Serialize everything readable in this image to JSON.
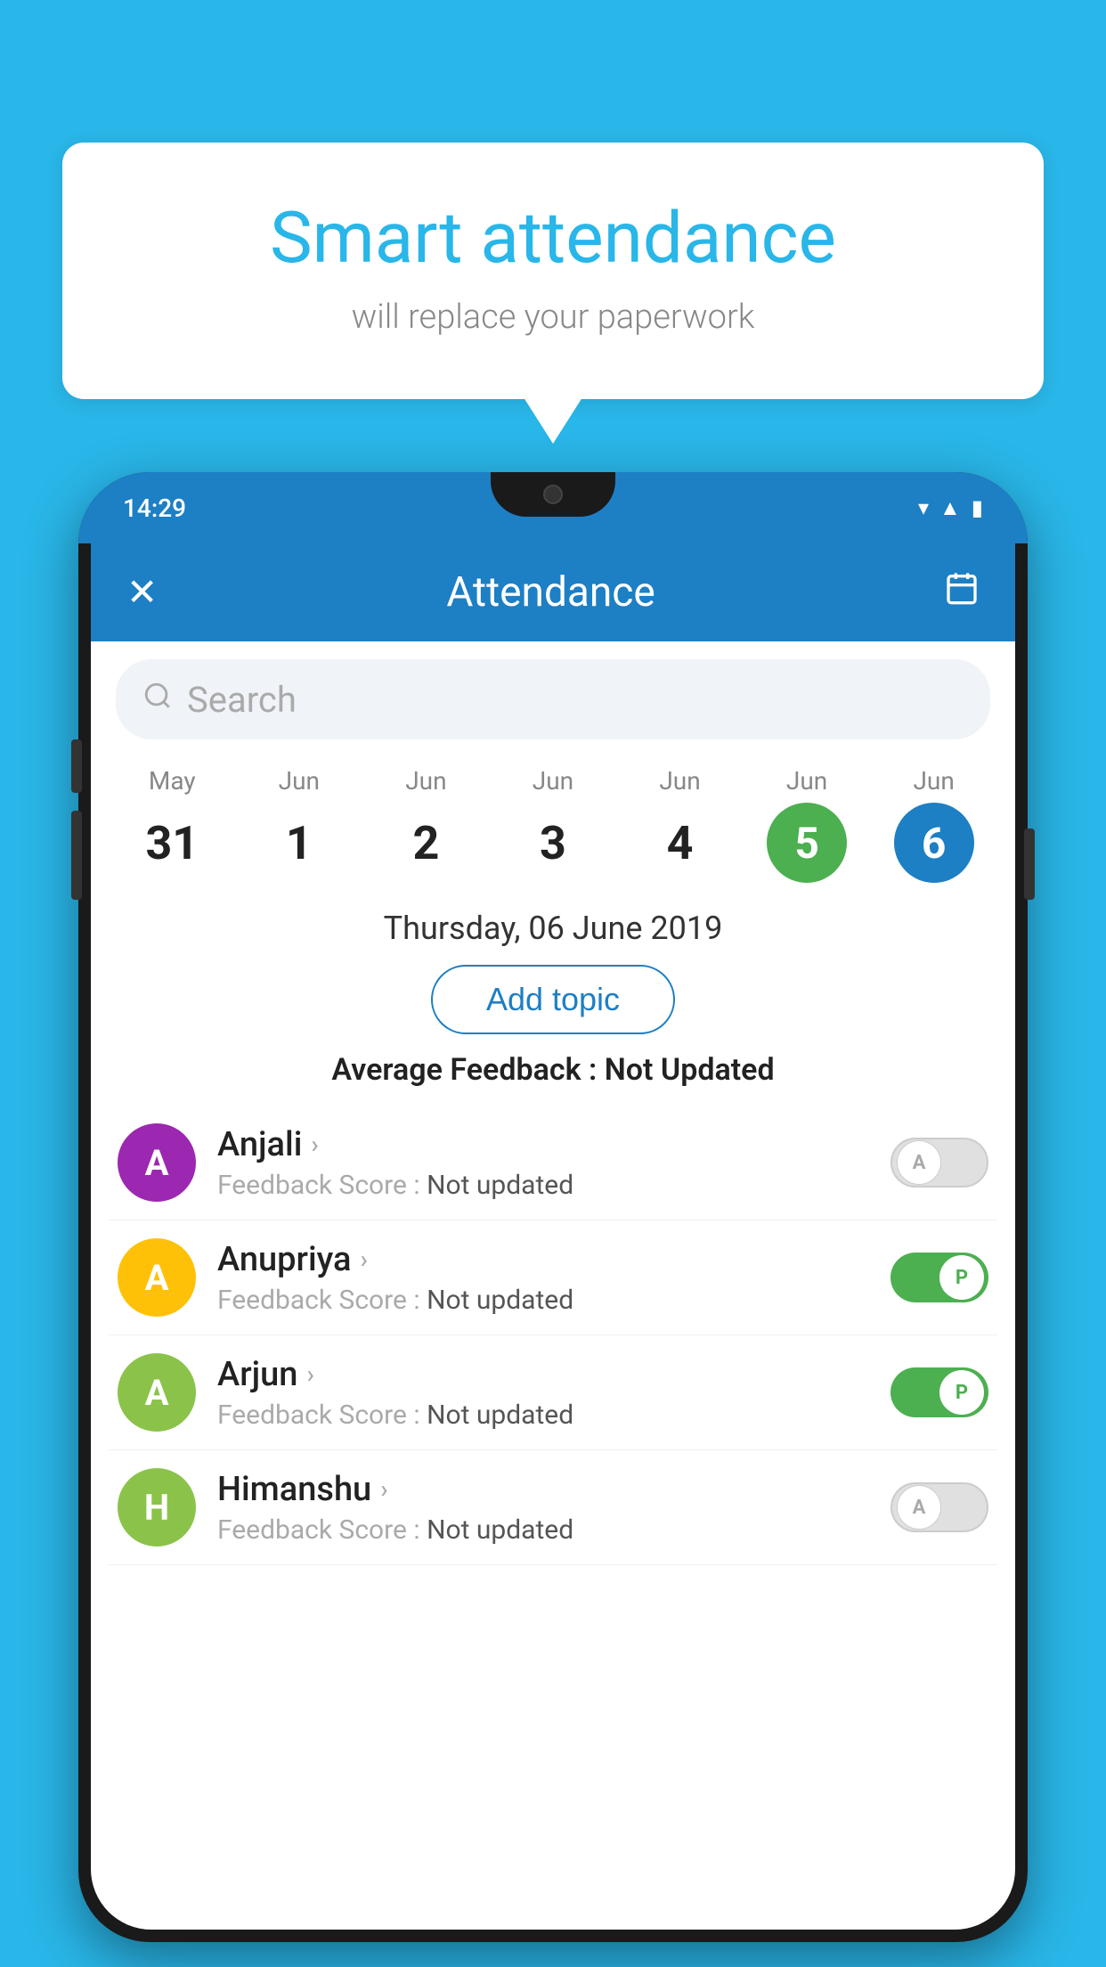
{
  "background_color": "#29b6e8",
  "bubble": {
    "title": "Smart attendance",
    "subtitle": "will replace your paperwork"
  },
  "status_bar": {
    "time": "14:29",
    "icons": [
      "wifi",
      "signal",
      "battery"
    ]
  },
  "header": {
    "title": "Attendance",
    "close_label": "✕",
    "calendar_icon": "📅"
  },
  "search": {
    "placeholder": "Search"
  },
  "calendar": {
    "days": [
      {
        "month": "May",
        "date": "31",
        "state": "normal"
      },
      {
        "month": "Jun",
        "date": "1",
        "state": "normal"
      },
      {
        "month": "Jun",
        "date": "2",
        "state": "normal"
      },
      {
        "month": "Jun",
        "date": "3",
        "state": "normal"
      },
      {
        "month": "Jun",
        "date": "4",
        "state": "normal"
      },
      {
        "month": "Jun",
        "date": "5",
        "state": "today"
      },
      {
        "month": "Jun",
        "date": "6",
        "state": "selected"
      }
    ]
  },
  "selected_date_label": "Thursday, 06 June 2019",
  "add_topic_label": "Add topic",
  "average_feedback": {
    "label": "Average Feedback : ",
    "value": "Not Updated"
  },
  "students": [
    {
      "name": "Anjali",
      "avatar_letter": "A",
      "avatar_color": "#9c27b0",
      "feedback": "Feedback Score : ",
      "feedback_value": "Not updated",
      "toggle": "off",
      "toggle_letter": "A"
    },
    {
      "name": "Anupriya",
      "avatar_letter": "A",
      "avatar_color": "#ffc107",
      "feedback": "Feedback Score : ",
      "feedback_value": "Not updated",
      "toggle": "on",
      "toggle_letter": "P"
    },
    {
      "name": "Arjun",
      "avatar_letter": "A",
      "avatar_color": "#8bc34a",
      "feedback": "Feedback Score : ",
      "feedback_value": "Not updated",
      "toggle": "on",
      "toggle_letter": "P"
    },
    {
      "name": "Himanshu",
      "avatar_letter": "H",
      "avatar_color": "#8bc34a",
      "feedback": "Feedback Score : ",
      "feedback_value": "Not updated",
      "toggle": "off",
      "toggle_letter": "A"
    }
  ]
}
